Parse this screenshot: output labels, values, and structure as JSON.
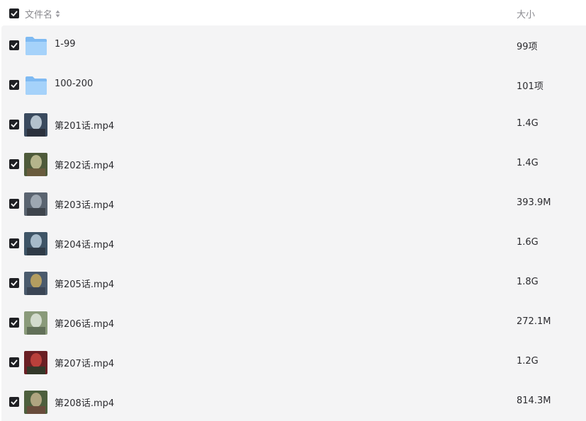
{
  "header": {
    "name_label": "文件名",
    "size_label": "大小",
    "select_all_checked": true
  },
  "files": [
    {
      "name": "1-99",
      "size": "99项",
      "type": "folder",
      "checked": true
    },
    {
      "name": "100-200",
      "size": "101项",
      "type": "folder",
      "checked": true
    },
    {
      "name": "第201话.mp4",
      "size": "1.4G",
      "type": "video",
      "checked": true
    },
    {
      "name": "第202话.mp4",
      "size": "1.4G",
      "type": "video",
      "checked": true
    },
    {
      "name": "第203话.mp4",
      "size": "393.9M",
      "type": "video",
      "checked": true
    },
    {
      "name": "第204话.mp4",
      "size": "1.6G",
      "type": "video",
      "checked": true
    },
    {
      "name": "第205话.mp4",
      "size": "1.8G",
      "type": "video",
      "checked": true
    },
    {
      "name": "第206话.mp4",
      "size": "272.1M",
      "type": "video",
      "checked": true
    },
    {
      "name": "第207话.mp4",
      "size": "1.2G",
      "type": "video",
      "checked": true
    },
    {
      "name": "第208话.mp4",
      "size": "814.3M",
      "type": "video",
      "checked": true
    }
  ],
  "colors": {
    "checkbox": "#1f2024",
    "folder": "#8ec5f7",
    "row_background": "#f4f4f5",
    "header_text": "#8a8a8f",
    "text": "#2b2b2f"
  }
}
